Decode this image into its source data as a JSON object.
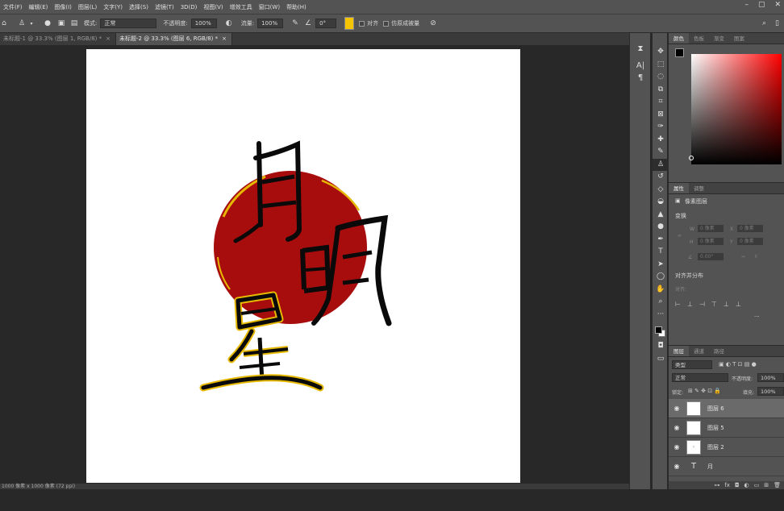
{
  "menu": {
    "items": [
      "文件(F)",
      "编辑(E)",
      "图像(I)",
      "图层(L)",
      "文字(Y)",
      "选择(S)",
      "滤镜(T)",
      "3D(D)",
      "视图(V)",
      "增效工具",
      "窗口(W)",
      "帮助(H)"
    ]
  },
  "options": {
    "mode_label": "模式:",
    "mode_value": "正常",
    "opacity_label": "不透明度:",
    "opacity_value": "100%",
    "flow_label": "流量:",
    "flow_value": "100%",
    "angle_value": "0°",
    "align_label": "对齐",
    "sample_label": "仿原成被量",
    "swatch_color": "#f5c400"
  },
  "tabs": [
    {
      "label": "未标题-1 @ 33.3% (图层 1, RGB/8) *",
      "close": "×"
    },
    {
      "label": "未标题-2 @ 33.3% (图层 6, RGB/8) *",
      "close": "×"
    }
  ],
  "canvas": {
    "circle_color": "#a80d0d",
    "ink_color": "#0a0a0a",
    "gold_color": "#e6b800"
  },
  "status": {
    "text": "1000 像素 x 1000 像素 (72 ppi)"
  },
  "color_panel": {
    "tabs": [
      "颜色",
      "色板",
      "渐变",
      "图案"
    ]
  },
  "properties_panel": {
    "tabs": [
      "属性",
      "调整"
    ],
    "type_label": "像素图层",
    "transform_label": "变换",
    "w_label": "W",
    "w_value": "0 像素",
    "h_label": "H",
    "h_value": "0 像素",
    "x_label": "X",
    "x_value": "0 像素",
    "y_label": "Y",
    "y_value": "0 像素",
    "angle_value": "0.00°",
    "align_section": "对齐并分布",
    "align_sub": "对齐:",
    "more": "···"
  },
  "layers_panel": {
    "tabs": [
      "图层",
      "通道",
      "路径"
    ],
    "filter_value": "类型",
    "blend_value": "正常",
    "opacity_label": "不透明度:",
    "opacity_value": "100%",
    "lock_label": "锁定:",
    "fill_label": "填充:",
    "fill_value": "100%",
    "layers": [
      {
        "name": "图层 6",
        "selected": true,
        "kind": "pixel"
      },
      {
        "name": "图层 5",
        "selected": false,
        "kind": "pixel"
      },
      {
        "name": "图层 2",
        "selected": false,
        "kind": "pixel"
      },
      {
        "name": "月",
        "selected": false,
        "kind": "text"
      }
    ]
  }
}
